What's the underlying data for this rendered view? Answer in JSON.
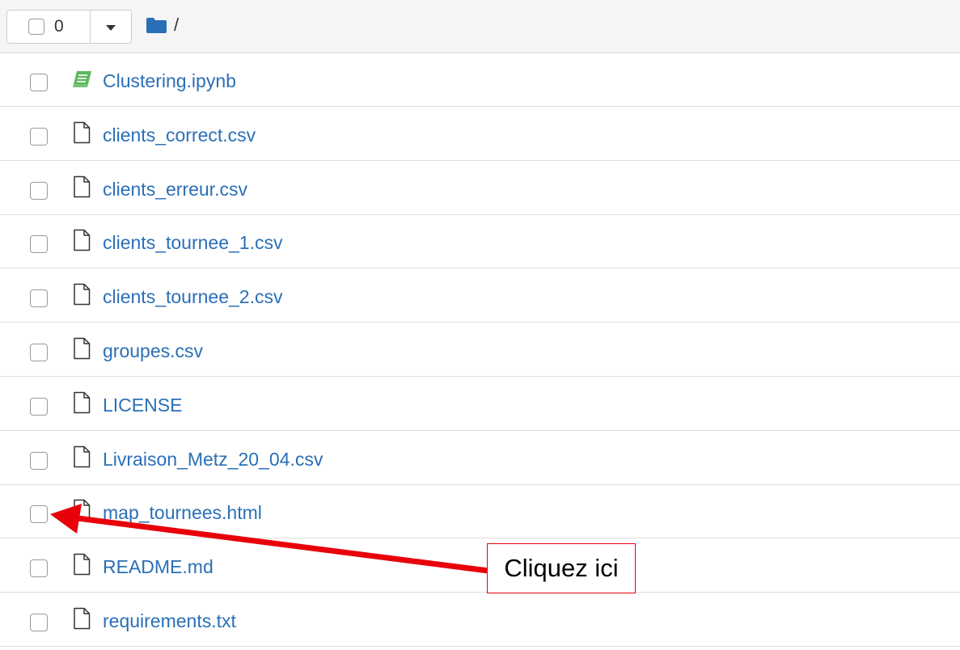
{
  "toolbar": {
    "selected_count": "0",
    "breadcrumb_separator": "/",
    "folder_icon": "folder-icon"
  },
  "files": [
    {
      "name": "Clustering.ipynb",
      "icon": "notebook-icon",
      "icon_color": "#5cb85c"
    },
    {
      "name": "clients_correct.csv",
      "icon": "file-icon"
    },
    {
      "name": "clients_erreur.csv",
      "icon": "file-icon"
    },
    {
      "name": "clients_tournee_1.csv",
      "icon": "file-icon"
    },
    {
      "name": "clients_tournee_2.csv",
      "icon": "file-icon"
    },
    {
      "name": "groupes.csv",
      "icon": "file-icon"
    },
    {
      "name": "LICENSE",
      "icon": "file-icon"
    },
    {
      "name": "Livraison_Metz_20_04.csv",
      "icon": "file-icon"
    },
    {
      "name": "map_tournees.html",
      "icon": "file-icon"
    },
    {
      "name": "README.md",
      "icon": "file-icon"
    },
    {
      "name": "requirements.txt",
      "icon": "file-icon"
    }
  ],
  "annotation": {
    "label": "Cliquez ici",
    "color": "#e8000b"
  },
  "colors": {
    "link": "#2a6fb8",
    "folder": "#2a6fb8",
    "toolbar_bg": "#f5f5f5",
    "divider": "#dddddd"
  }
}
